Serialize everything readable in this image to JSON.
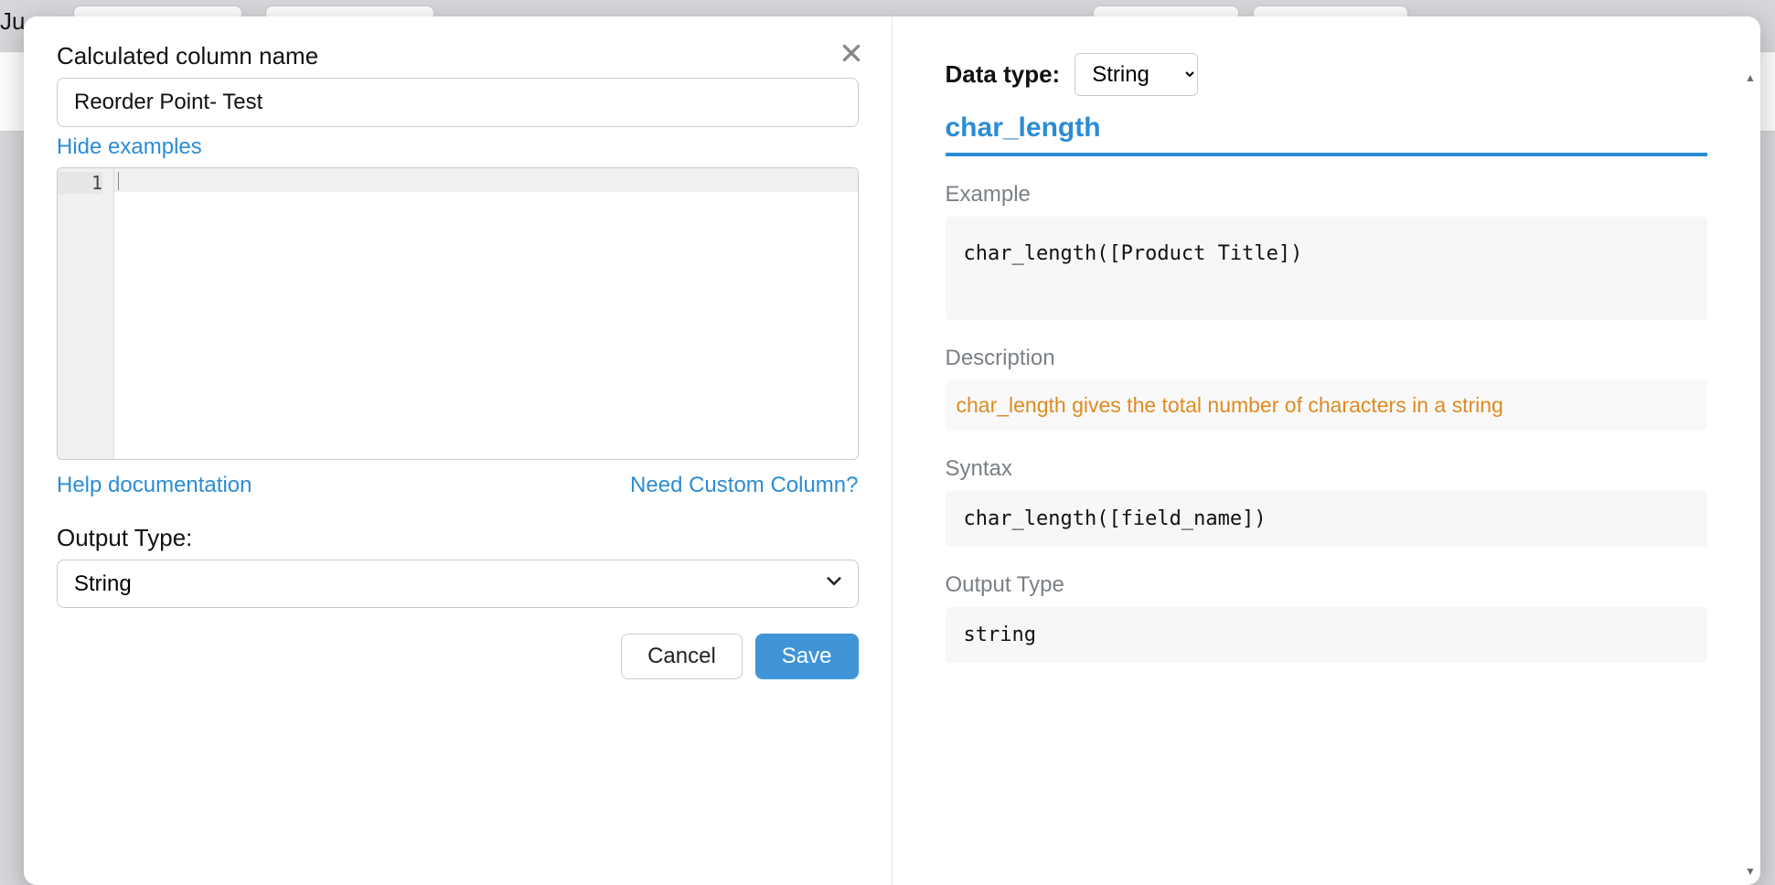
{
  "background": {
    "topLeftFragment": "Ju"
  },
  "modal": {
    "left": {
      "nameLabel": "Calculated column name",
      "nameValue": "Reorder Point- Test",
      "hideExamples": "Hide examples",
      "editor": {
        "lineNumber": "1"
      },
      "helpDoc": "Help documentation",
      "needCustom": "Need Custom Column?",
      "outputTypeLabel": "Output Type:",
      "outputTypeSelected": "String",
      "cancel": "Cancel",
      "save": "Save"
    },
    "right": {
      "dataTypeLabel": "Data type:",
      "dataTypeSelected": "String",
      "functionName": "char_length",
      "exampleLabel": "Example",
      "exampleCode": "char_length([Product Title])",
      "descriptionLabel": "Description",
      "descriptionText": "char_length gives the total number of characters in a string",
      "syntaxLabel": "Syntax",
      "syntaxCode": "char_length([field_name])",
      "outputTypeLabel": "Output Type",
      "outputTypeValue": "string"
    }
  }
}
